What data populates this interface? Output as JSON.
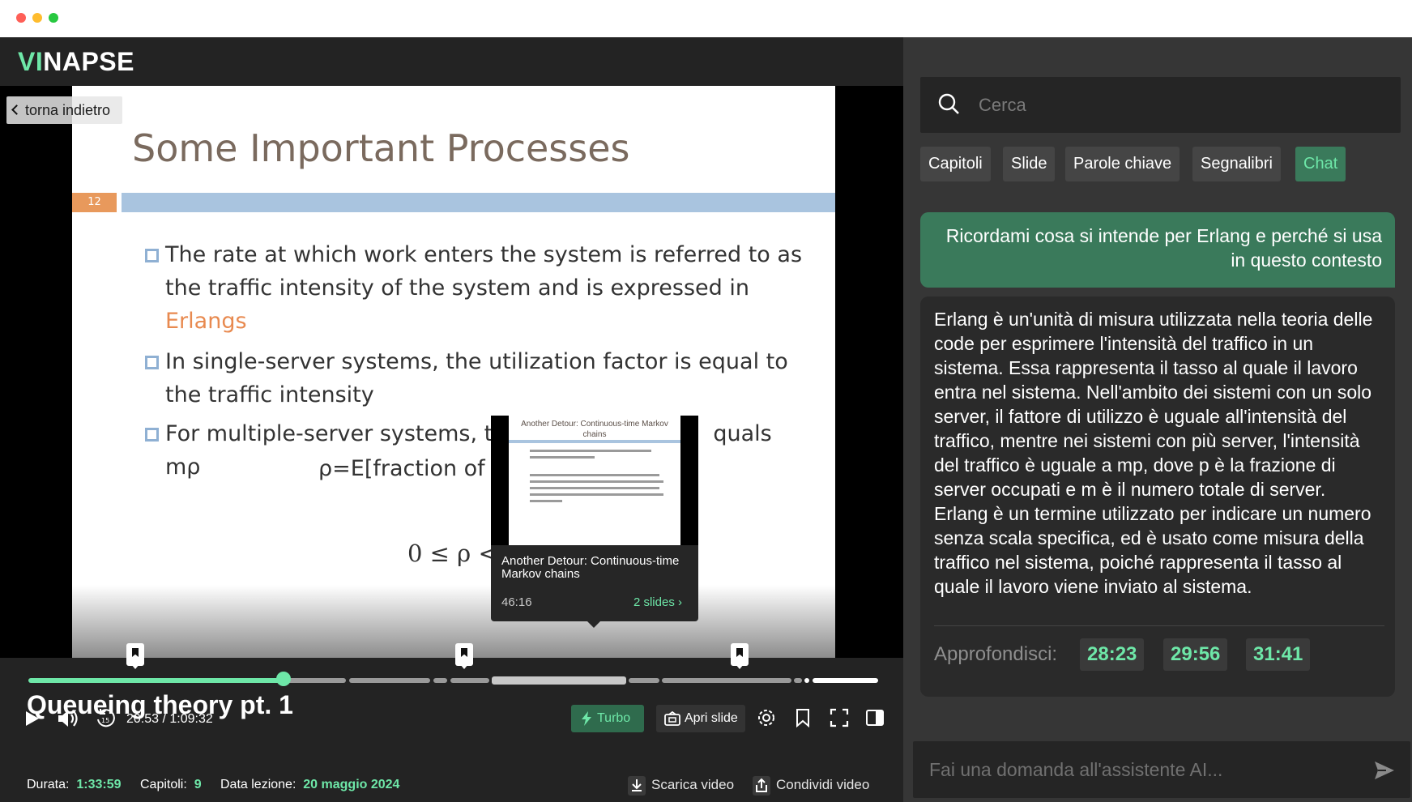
{
  "brand": {
    "prefix": "VI",
    "suffix": "NAPSE"
  },
  "video": {
    "back_label": "torna indietro",
    "slide": {
      "title": "Some Important Processes",
      "number": "12",
      "bullet1_a": "The rate at which work enters the system is referred to as the traffic intensity of the system and is expressed in ",
      "bullet1_b": "Erlangs",
      "bullet2": "In single-server systems, the utilization factor is equal to the traffic intensity",
      "bullet3_a": "For multiple-server systems, th",
      "bullet3_b": "quals mρ",
      "formula1": "ρ=E[fraction of",
      "formula2": "0 ≤ ρ <"
    },
    "preview": {
      "slide_title": "Another Detour: Continuous-time Markov chains",
      "title": "Another Detour: Continuous-time Markov chains",
      "time": "46:16",
      "link": "2 slides"
    },
    "progress": {
      "played_fraction": 0.3
    }
  },
  "controls": {
    "time": "20:53 / 1:09:32",
    "turbo": "Turbo",
    "apri": "Apri slide",
    "colors": {
      "accent": "#6ee7a8",
      "accent_dark": "#3a7a5b"
    }
  },
  "lecture": {
    "title": "Queueing theory pt. 1",
    "durata_label": "Durata:",
    "durata": "1:33:59",
    "capitoli_label": "Capitoli:",
    "capitoli": "9",
    "data_label": "Data lezione:",
    "data": "20 maggio 2024",
    "download": "Scarica video",
    "share": "Condividi video"
  },
  "sidebar": {
    "search_placeholder": "Cerca",
    "tabs": [
      "Capitoli",
      "Slide",
      "Parole chiave",
      "Segnalibri",
      "Chat"
    ],
    "active_tab": "Chat",
    "user_message": "Ricordami cosa si intende per Erlang e perché si usa in questo contesto",
    "bot_message": "Erlang è un'unità di misura utilizzata nella teoria delle code per esprimere l'intensità del traffico in un sistema. Essa rappresenta il tasso al quale il lavoro entra nel sistema. Nell'ambito dei sistemi con un solo server, il fattore di utilizzo è uguale all'intensità del traffico, mentre nei sistemi con più server, l'intensità del traffico è uguale a mp, dove p è la frazione di server occupati e m è il numero totale di server. Erlang è un termine utilizzato per indicare un numero senza scala specifica, ed è usato come misura della traffico nel sistema, poiché rappresenta il tasso al quale il lavoro viene inviato al sistema.",
    "deep_label": "Approfondisci:",
    "timestamps": [
      "28:23",
      "29:56",
      "31:41"
    ],
    "ask_placeholder": "Fai una domanda all'assistente AI..."
  }
}
